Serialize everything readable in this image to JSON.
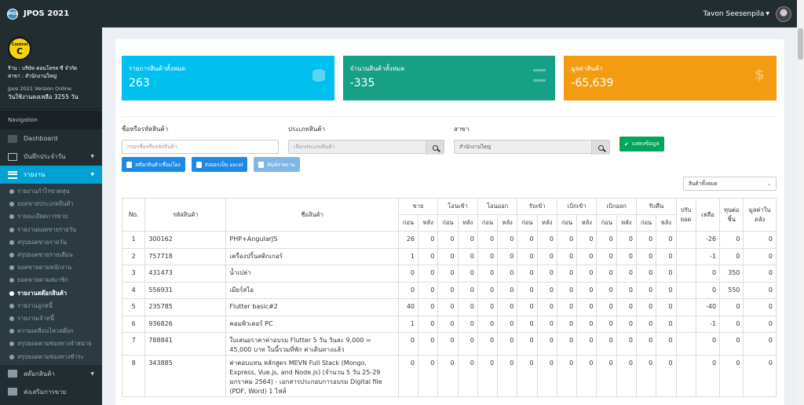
{
  "app": {
    "title": "JPOS 2021",
    "logo_text": "JPOS"
  },
  "topbar": {
    "user_name": "Tavon Seesenpila"
  },
  "sidebar": {
    "badge_top": "Control",
    "badge_letter": "C",
    "shop_line": "ร้าน : บริษัท คอนโทรล ซี จำกัด",
    "branch_line": "สาขา : สำนักงานใหญ่",
    "version_line": "Jpos 2021 Version Online",
    "days_line": "วันใช้งานคงเหลือ 3255 วัน",
    "nav_header": "Navigation",
    "items": [
      {
        "label": "Dashboard"
      },
      {
        "label": "บันทึกประจำวัน"
      },
      {
        "label": "รายงาน"
      }
    ],
    "sub_items": [
      "รายงานกำไรขาดทุน",
      "ยอดขายประเภทสินค้า",
      "รายละเอียดการขาย",
      "รายงานยอดขายรายวัน",
      "สรุปยอดขายรายวัน",
      "สรุปยอดขายรายเดือน",
      "ยอดขายตามพนักงาน",
      "ยอดขายตามสมาชิก",
      "รายงานสต๊อกสินค้า",
      "รายงานลูกหนี้",
      "รายงานเจ้าหนี้",
      "ความเคลื่อนไหวสต๊อก",
      "สรุปยอดตามช่องทางจำหน่าย",
      "สรุปยอดตามช่องทางชำระ"
    ],
    "bottom_items": [
      {
        "label": "สต๊อกสินค้า"
      },
      {
        "label": "ส่งเสริมการขาย"
      }
    ]
  },
  "info": [
    {
      "label": "รายการสินค้าทั้งหมด",
      "value": "263",
      "icon": "database-icon",
      "color": "#00c0ef"
    },
    {
      "label": "จำนวนสินค้าทั้งหมด",
      "value": "-335",
      "icon": "list-icon",
      "color": "#16a085"
    },
    {
      "label": "มูลค่าสินค้า",
      "value": "-65,639",
      "icon": "dollar-icon",
      "color": "#f39c12"
    }
  ],
  "filters": {
    "name_label": "ชื่อหรือรหัสสินค้า",
    "name_placeholder": "กรอกชื่อหรือรหัสสินค้า",
    "type_label": "ประเภทสินค้า",
    "type_placeholder": "เลือกประเภทสินค้า",
    "branch_label": "สาขา",
    "branch_value": "สำนักงานใหญ่",
    "show_button": "แสดงข้อมูล"
  },
  "actions": {
    "print_link": "สต๊อกสินค้าเชื่อมโยง",
    "export_excel": "ส่งออกเป็น excel",
    "print_report": "พิมพ์รายงาน"
  },
  "select_value": "สินค้าทั้งหมด",
  "table": {
    "headers": {
      "no": "No.",
      "code": "รหัสสินค้า",
      "name": "ชื่อสินค้า",
      "sell": "ขาย",
      "transfer_in": "โอนเข้า",
      "transfer_out": "โอนออก",
      "receive": "รับเข้า",
      "withdraw_in": "เบิกเข้า",
      "withdraw_out": "เบิกออก",
      "return": "รับคืน",
      "adjust": "ปรับยอด",
      "remain": "เหลือ",
      "cost": "ทุนต่อชิ้น",
      "value": "มูลค่าในคลัง",
      "before": "ก่อน",
      "after": "หลัง"
    },
    "rows": [
      {
        "no": "1",
        "code": "300162",
        "name": "PHP+AngularJS",
        "v": [
          "26",
          "0",
          "0",
          "0",
          "0",
          "0",
          "0",
          "0",
          "0",
          "0",
          "0",
          "0",
          "0",
          "0"
        ],
        "adjust": "",
        "remain": "-26",
        "cost": "0",
        "value": "0"
      },
      {
        "no": "2",
        "code": "757718",
        "name": "เครื่องปริ้นสติกเกอร์",
        "v": [
          "1",
          "0",
          "0",
          "0",
          "0",
          "0",
          "0",
          "0",
          "0",
          "0",
          "0",
          "0",
          "0",
          "0"
        ],
        "adjust": "",
        "remain": "-1",
        "cost": "0",
        "value": "0"
      },
      {
        "no": "3",
        "code": "431473",
        "name": "น้ำเปล่า",
        "v": [
          "0",
          "0",
          "0",
          "0",
          "0",
          "0",
          "0",
          "0",
          "0",
          "0",
          "0",
          "0",
          "0",
          "0"
        ],
        "adjust": "",
        "remain": "0",
        "cost": "350",
        "value": "0"
      },
      {
        "no": "4",
        "code": "556931",
        "name": "เมียร์สไอ",
        "v": [
          "0",
          "0",
          "0",
          "0",
          "0",
          "0",
          "0",
          "0",
          "0",
          "0",
          "0",
          "0",
          "0",
          "0"
        ],
        "adjust": "",
        "remain": "0",
        "cost": "550",
        "value": "0"
      },
      {
        "no": "5",
        "code": "235785",
        "name": "Flutter basic#2",
        "v": [
          "40",
          "0",
          "0",
          "0",
          "0",
          "0",
          "0",
          "0",
          "0",
          "0",
          "0",
          "0",
          "0",
          "0"
        ],
        "adjust": "",
        "remain": "-40",
        "cost": "0",
        "value": "0"
      },
      {
        "no": "6",
        "code": "936826",
        "name": "คอมพิวเตอร์ PC",
        "v": [
          "1",
          "0",
          "0",
          "0",
          "0",
          "0",
          "0",
          "0",
          "0",
          "0",
          "0",
          "0",
          "0",
          "0"
        ],
        "adjust": "",
        "remain": "-1",
        "cost": "0",
        "value": "0"
      },
      {
        "no": "7",
        "code": "788841",
        "name": "ใบเสนอราคาค่าอบรม Flutter 5 วัน วันละ 9,000 = 45,000 บาท ในนี้รวมที่พัก ค่าเดินทางแล้ว",
        "v": [
          "0",
          "0",
          "0",
          "0",
          "0",
          "0",
          "0",
          "0",
          "0",
          "0",
          "0",
          "0",
          "0",
          "0"
        ],
        "adjust": "",
        "remain": "0",
        "cost": "0",
        "value": "0"
      },
      {
        "no": "8",
        "code": "343885",
        "name": "ค่าตอบแทน หลักสูตร MEVN Full Stack (Mongo, Express, Vue.js, and Node.js) (จำนวน 5 วัน 25-29 มกราคม 2564) - เอกสารประกอบการอบรม Digital file (PDF, Word) 1 ไฟล์",
        "v": [
          "0",
          "0",
          "0",
          "0",
          "0",
          "0",
          "0",
          "0",
          "0",
          "0",
          "0",
          "0",
          "0",
          "0"
        ],
        "adjust": "",
        "remain": "0",
        "cost": "0",
        "value": "0"
      }
    ]
  }
}
